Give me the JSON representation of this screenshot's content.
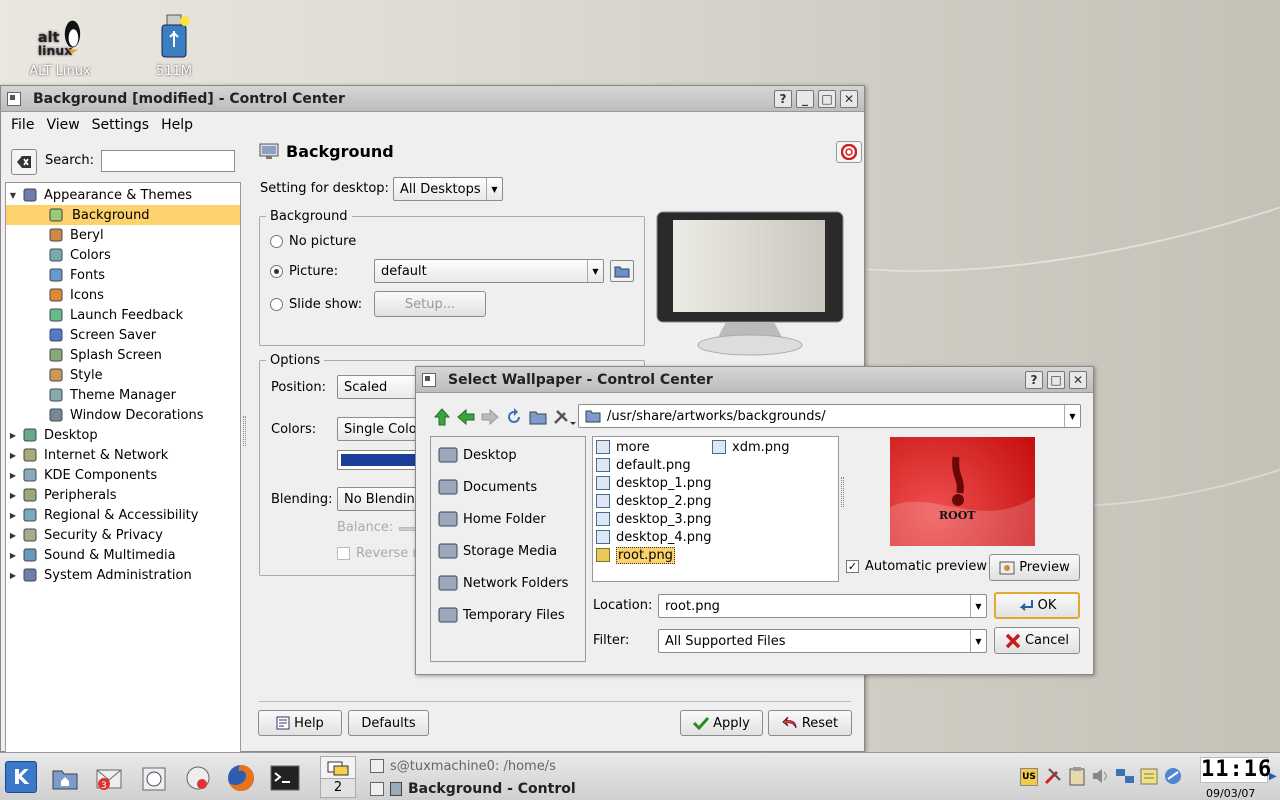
{
  "desktop": {
    "icons": [
      {
        "label": "ALT Linux",
        "name": "alt-linux-logo-icon"
      },
      {
        "label": "511M",
        "name": "usb-drive-icon"
      }
    ]
  },
  "control_center": {
    "title": "Background [modified] - Control Center",
    "menu": {
      "file": "File",
      "view": "View",
      "settings": "Settings",
      "help": "Help"
    },
    "search_label": "Search:",
    "search_value": "",
    "tree": [
      {
        "label": "Appearance & Themes",
        "expanded": true,
        "icon": "appearance-icon"
      },
      {
        "label": "Background",
        "child": true,
        "selected": true,
        "icon": "background-icon"
      },
      {
        "label": "Beryl",
        "child": true,
        "icon": "beryl-icon"
      },
      {
        "label": "Colors",
        "child": true,
        "icon": "colors-icon"
      },
      {
        "label": "Fonts",
        "child": true,
        "icon": "fonts-icon"
      },
      {
        "label": "Icons",
        "child": true,
        "icon": "icons-icon"
      },
      {
        "label": "Launch Feedback",
        "child": true,
        "icon": "rocket-icon"
      },
      {
        "label": "Screen Saver",
        "child": true,
        "icon": "screensaver-icon"
      },
      {
        "label": "Splash Screen",
        "child": true,
        "icon": "splash-icon"
      },
      {
        "label": "Style",
        "child": true,
        "icon": "style-icon"
      },
      {
        "label": "Theme Manager",
        "child": true,
        "icon": "theme-manager-icon"
      },
      {
        "label": "Window Decorations",
        "child": true,
        "icon": "window-decorations-icon"
      },
      {
        "label": "Desktop",
        "icon": "desktop-icon"
      },
      {
        "label": "Internet & Network",
        "icon": "network-icon"
      },
      {
        "label": "KDE Components",
        "icon": "kde-components-icon"
      },
      {
        "label": "Peripherals",
        "icon": "peripherals-icon"
      },
      {
        "label": "Regional & Accessibility",
        "icon": "regional-icon"
      },
      {
        "label": "Security & Privacy",
        "icon": "security-icon"
      },
      {
        "label": "Sound & Multimedia",
        "icon": "sound-icon"
      },
      {
        "label": "System Administration",
        "icon": "system-admin-icon"
      }
    ],
    "panel": {
      "heading": "Background",
      "setting_for_label": "Setting for desktop:",
      "setting_for_value": "All Desktops",
      "background_group": "Background",
      "no_picture": "No picture",
      "picture": "Picture:",
      "picture_value": "default",
      "slide_show": "Slide show:",
      "setup": "Setup...",
      "options_group": "Options",
      "position_label": "Position:",
      "position_value": "Scaled",
      "colors_label": "Colors:",
      "colors_value": "Single Colo",
      "blending_label": "Blending:",
      "blending_value": "No Blending",
      "balance_label": "Balance:",
      "reverse_label": "Reverse r",
      "primary_color": "#1c3f99"
    },
    "buttons": {
      "help": "Help",
      "defaults": "Defaults",
      "apply": "Apply",
      "reset": "Reset"
    }
  },
  "wallpaper_dialog": {
    "title": "Select Wallpaper - Control Center",
    "path": "/usr/share/artworks/backgrounds/",
    "places": [
      "Desktop",
      "Documents",
      "Home Folder",
      "Storage Media",
      "Network Folders",
      "Temporary Files"
    ],
    "files_col1": [
      "more",
      "default.png",
      "desktop_1.png",
      "desktop_2.png",
      "desktop_3.png",
      "desktop_4.png",
      "root.png"
    ],
    "files_col2": [
      "xdm.png"
    ],
    "selected_file": "root.png",
    "preview_text": "ROOT",
    "automatic_preview": "Automatic preview",
    "preview_button": "Preview",
    "location_label": "Location:",
    "location_value": "root.png",
    "filter_label": "Filter:",
    "filter_value": "All Supported Files",
    "ok": "OK",
    "cancel": "Cancel"
  },
  "taskbar": {
    "pager_number": "2",
    "tasks": [
      "s@tuxmachine0: /home/s",
      "Background - Control"
    ],
    "keyboard_layout": "US",
    "clock_time": "11:16",
    "clock_date": "09/03/07"
  }
}
